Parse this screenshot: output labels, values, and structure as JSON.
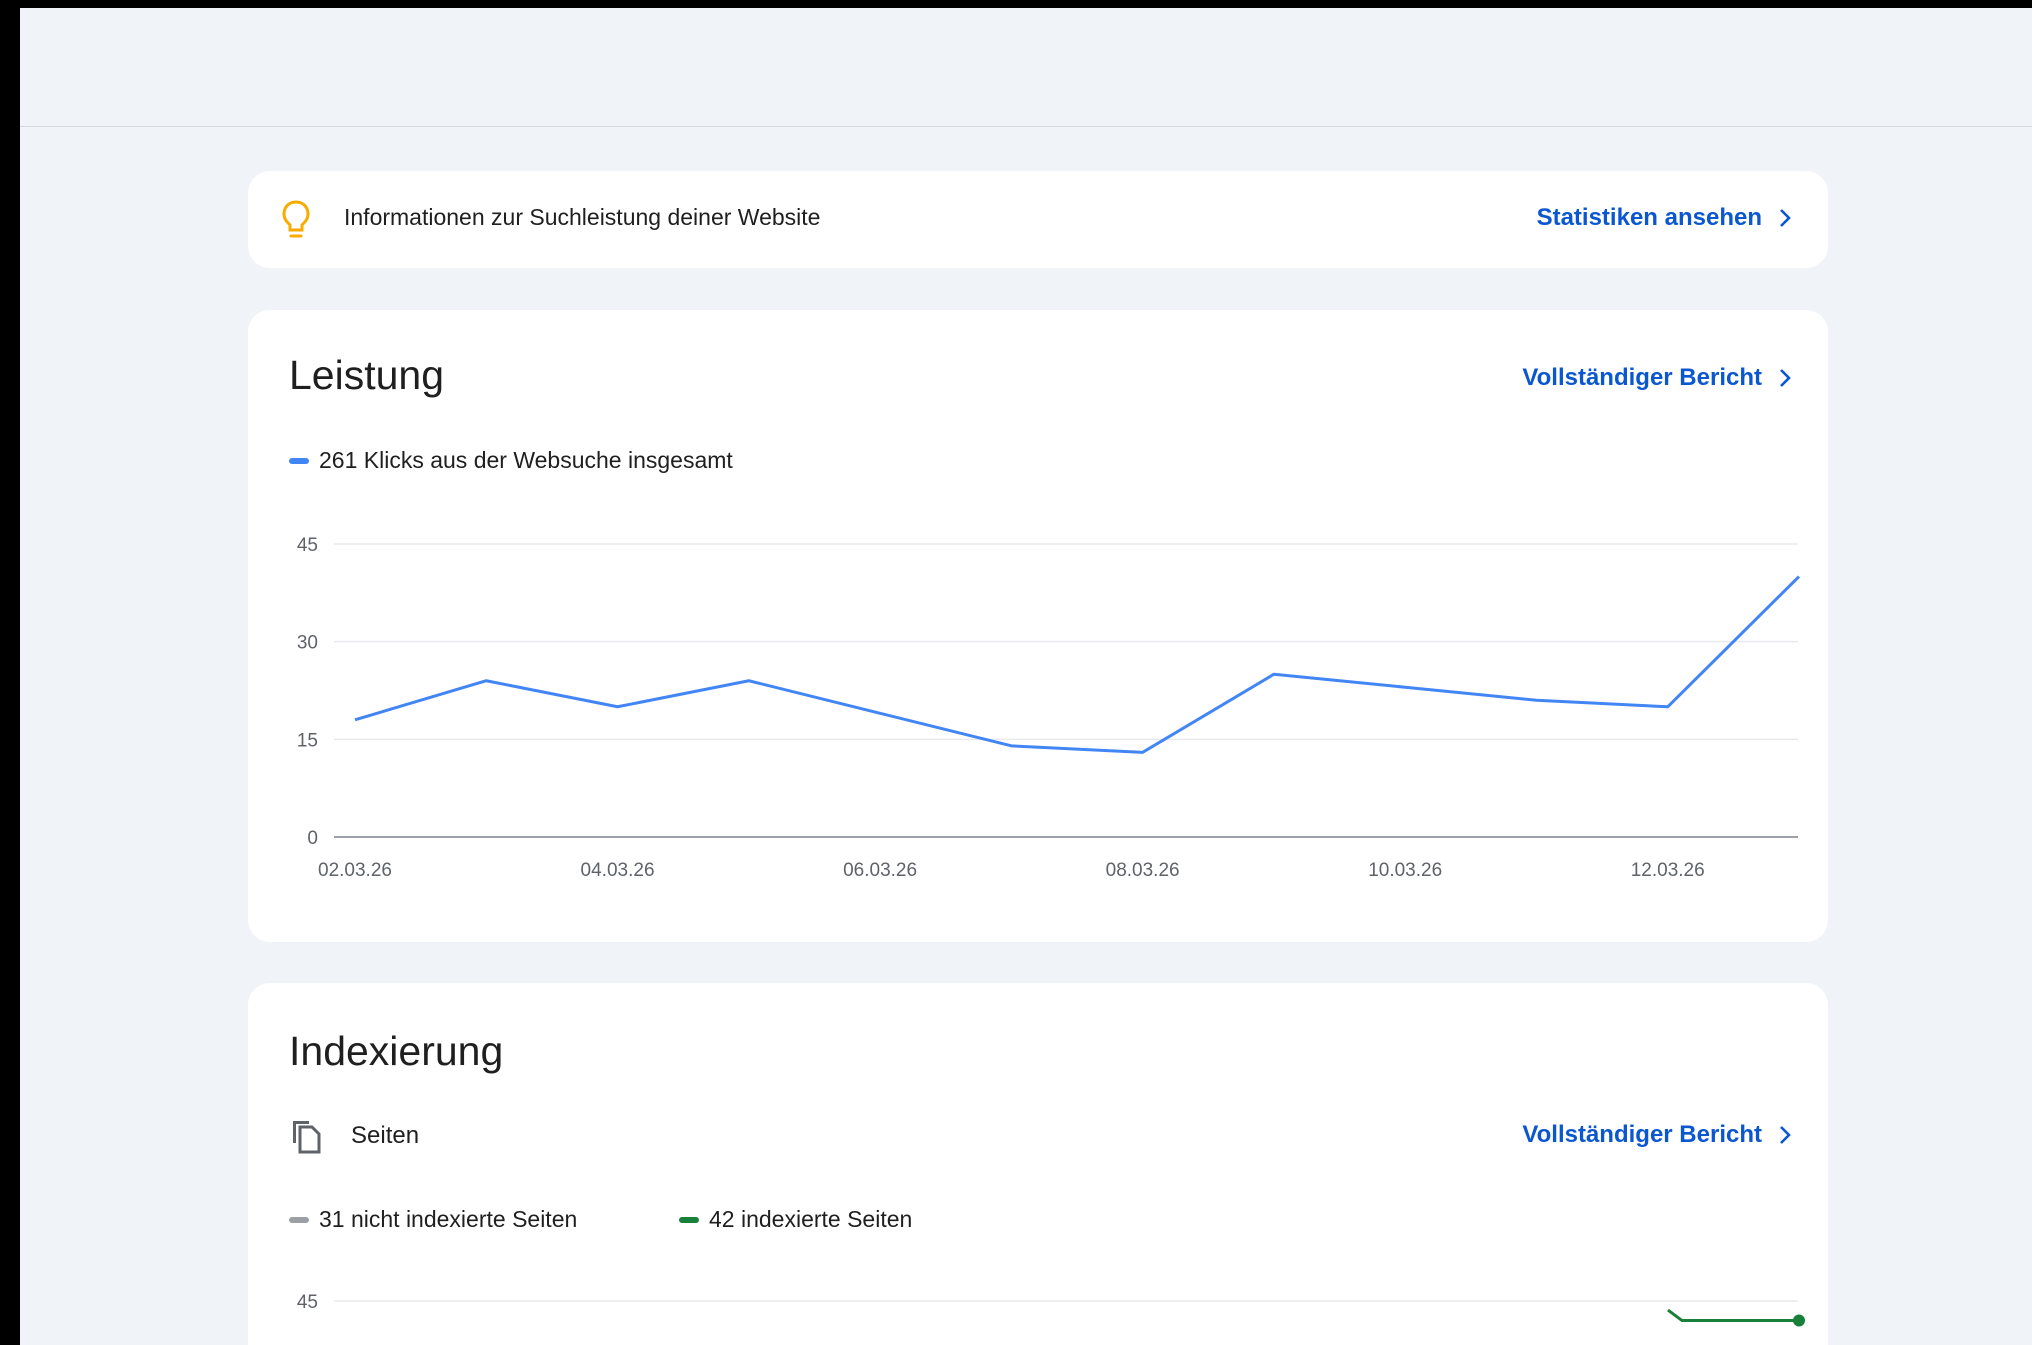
{
  "insight": {
    "text": "Informationen zur Suchleistung deiner Website",
    "link": "Statistiken ansehen",
    "icon": "lightbulb-icon"
  },
  "performance": {
    "title": "Leistung",
    "link": "Vollständiger Bericht",
    "legend": "261 Klicks aus der Websuche insgesamt",
    "color": "#4285f4"
  },
  "indexing": {
    "title": "Indexierung",
    "pages_label": "Seiten",
    "link": "Vollständiger Bericht",
    "legend_not_indexed": "31 nicht indexierte Seiten",
    "legend_indexed": "42 indexierte Seiten",
    "color_not_indexed": "#9aa0a6",
    "color_indexed": "#188038",
    "y_tick_top": "45"
  },
  "chart_data": [
    {
      "type": "line",
      "series": [
        {
          "name": "261 Klicks aus der Websuche insgesamt",
          "x": [
            "02.03.26",
            "03.03.26",
            "04.03.26",
            "05.03.26",
            "06.03.26",
            "07.03.26",
            "08.03.26",
            "09.03.26",
            "10.03.26",
            "11.03.26",
            "12.03.26",
            "13.03.26"
          ],
          "values": [
            18,
            24,
            20,
            24,
            19,
            14,
            13,
            25,
            23,
            21,
            20,
            40
          ]
        }
      ],
      "x_tick_labels": [
        "02.03.26",
        "04.03.26",
        "06.03.26",
        "08.03.26",
        "10.03.26",
        "12.03.26"
      ],
      "y_ticks": [
        0,
        15,
        30,
        45
      ],
      "ylim": [
        0,
        45
      ],
      "grid": true
    },
    {
      "type": "line",
      "series": [
        {
          "name": "42 indexierte Seiten",
          "x": [
            "12.03.26",
            "13.03.26"
          ],
          "values": [
            43,
            42
          ]
        }
      ],
      "y_ticks": [
        45
      ],
      "ylim": [
        0,
        45
      ],
      "grid": true
    }
  ]
}
